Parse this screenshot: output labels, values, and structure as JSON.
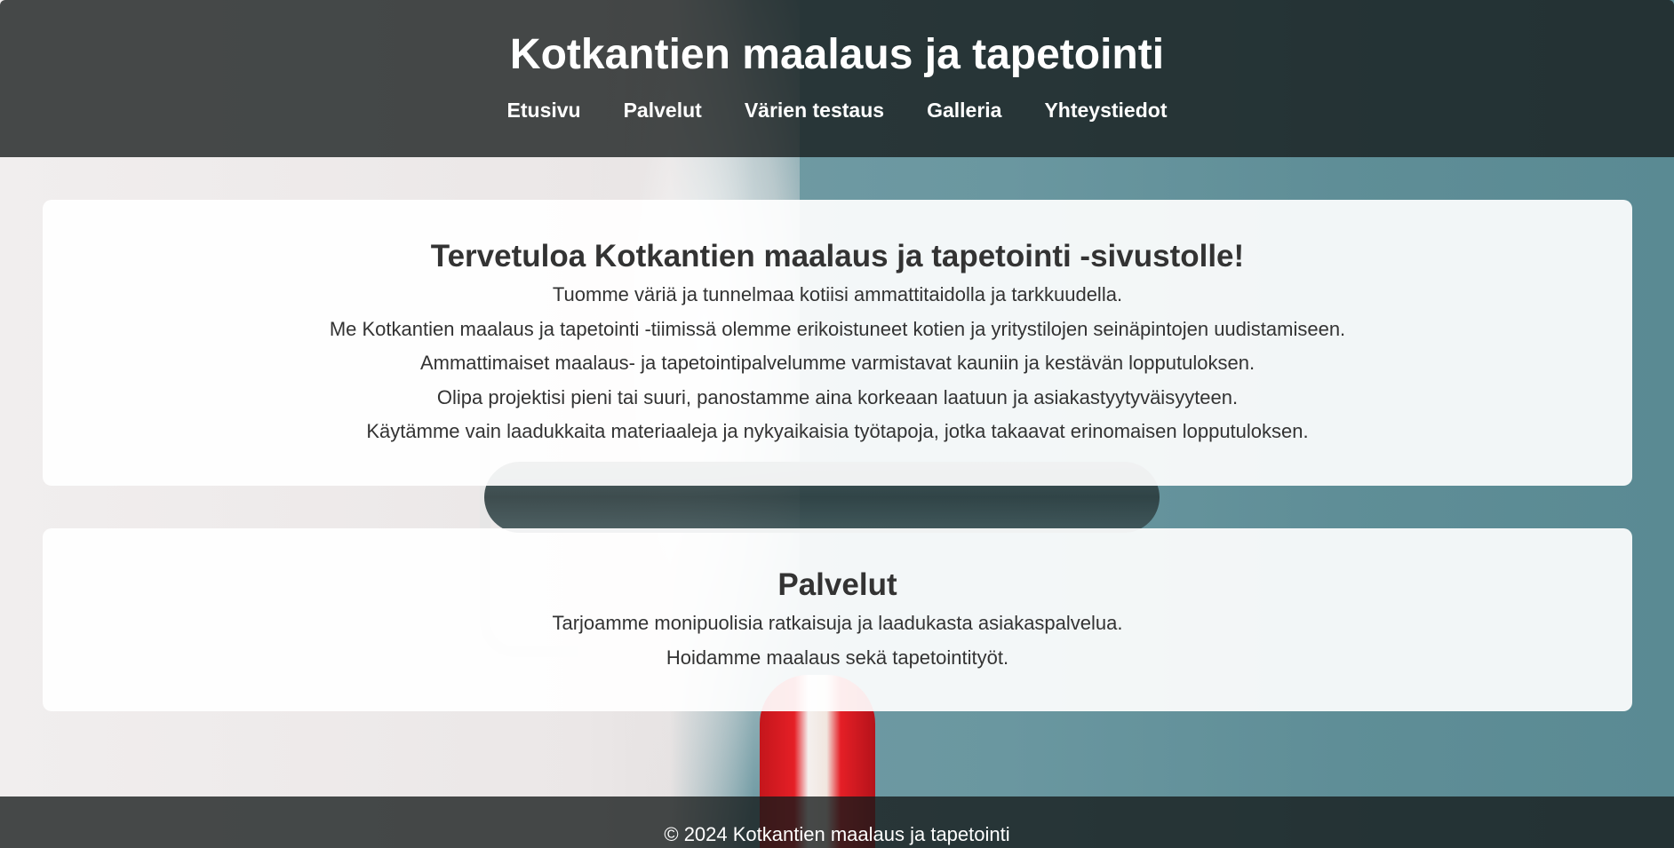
{
  "site": {
    "title": "Kotkantien maalaus ja tapetointi"
  },
  "nav": {
    "items": [
      {
        "label": "Etusivu"
      },
      {
        "label": "Palvelut"
      },
      {
        "label": "Värien testaus"
      },
      {
        "label": "Galleria"
      },
      {
        "label": "Yhteystiedot"
      }
    ]
  },
  "welcome": {
    "heading": "Tervetuloa Kotkantien maalaus ja tapetointi -sivustolle!",
    "paragraphs": [
      "Tuomme väriä ja tunnelmaa kotiisi ammattitaidolla ja tarkkuudella.",
      "Me Kotkantien maalaus ja tapetointi -tiimissä olemme erikoistuneet kotien ja yritystilojen seinäpintojen uudistamiseen.",
      "Ammattimaiset maalaus- ja tapetointipalvelumme varmistavat kauniin ja kestävän lopputuloksen.",
      "Olipa projektisi pieni tai suuri, panostamme aina korkeaan laatuun ja asiakastyytyväisyyteen.",
      "Käytämme vain laadukkaita materiaaleja ja nykyaikaisia työtapoja, jotka takaavat erinomaisen lopputuloksen."
    ]
  },
  "services": {
    "heading": "Palvelut",
    "paragraphs": [
      "Tarjoamme monipuolisia ratkaisuja ja laadukasta asiakaspalvelua.",
      "Hoidamme maalaus sekä tapetointityöt."
    ]
  },
  "footer": {
    "text": "© 2024 Kotkantien maalaus ja tapetointi"
  }
}
